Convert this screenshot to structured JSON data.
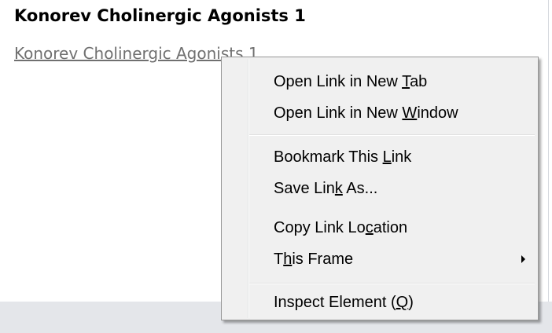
{
  "page": {
    "heading": "Konorev Cholinergic Agonists 1",
    "link_text": "Konorev Cholinergic Agonists 1"
  },
  "context_menu": {
    "groups": [
      {
        "items": [
          {
            "label_before": "Open Link in New ",
            "accel": "T",
            "label_after": "ab",
            "has_submenu": false
          },
          {
            "label_before": "Open Link in New ",
            "accel": "W",
            "label_after": "indow",
            "has_submenu": false
          }
        ]
      },
      {
        "items": [
          {
            "label_before": "Bookmark This ",
            "accel": "L",
            "label_after": "ink",
            "has_submenu": false
          },
          {
            "label_before": "Save Lin",
            "accel": "k",
            "label_after": " As...",
            "has_submenu": false
          },
          {
            "label_before": "Copy Link Lo",
            "accel": "c",
            "label_after": "ation",
            "has_submenu": false
          },
          {
            "label_before": "T",
            "accel": "h",
            "label_after": "is Frame",
            "has_submenu": true
          }
        ]
      },
      {
        "items": [
          {
            "label_before": "Inspect Element (",
            "accel": "Q",
            "label_after": ")",
            "has_submenu": false
          }
        ]
      }
    ]
  },
  "icons": {
    "submenu_arrow": "chevron-right-icon"
  },
  "colors": {
    "link": "#707070",
    "menu_background": "#f0f0f0",
    "menu_border": "#979797"
  }
}
